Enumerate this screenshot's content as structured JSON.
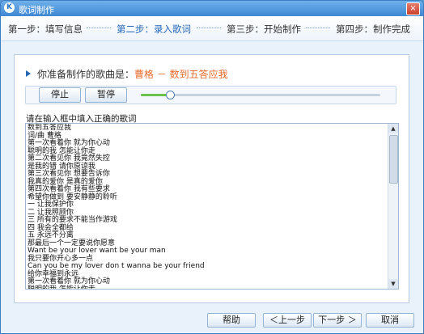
{
  "window": {
    "title": "歌词制作",
    "close_glyph": "×"
  },
  "steps": [
    {
      "label": "第一步：填写信息",
      "active": false
    },
    {
      "label": "第二步：录入歌词",
      "active": true
    },
    {
      "label": "第三步：开始制作",
      "active": false
    },
    {
      "label": "第四步：制作完成",
      "active": false
    }
  ],
  "song": {
    "prefix": "你准备制作的歌曲是：",
    "name": "曹格 － 数到五答应我"
  },
  "controls": {
    "stop_label": "停止",
    "pause_label": "暂停",
    "progress": 0.12
  },
  "lyrics": {
    "label": "请在输入框中填入正确的歌词",
    "lines": [
      "数到五答应我",
      "词/曲 曹格",
      "第一次看着你 就为你心动",
      "聪明的我 怎能让你走",
      "第二次看见你 我竟然失控",
      "是我的错 请你原谅我",
      "第三次看见你 想要告诉你",
      "我真的爱你 是真的爱你",
      "第四次看着你 我有些要求",
      "希望你做到 要安静静的聆听",
      "一 让我保护你",
      "二 让我照顾你",
      "三 所有的要求不能当作游戏",
      "四 我会全都给",
      "五 永远不分离",
      "那最后一个一定要说你愿意",
      "Want be your lover want be your man",
      "我只要你开心多一点",
      "Can you be my lover don t wanna be your friend",
      "给你幸福到永远",
      "第一次看着你 就为你心动",
      "聪明的我 怎能让你走",
      "第二次看见你 我竟然失控"
    ]
  },
  "footer": {
    "help_label": "帮助",
    "prev_label": "＜上一步",
    "next_label": "下一步 ＞",
    "cancel_label": "取消"
  }
}
